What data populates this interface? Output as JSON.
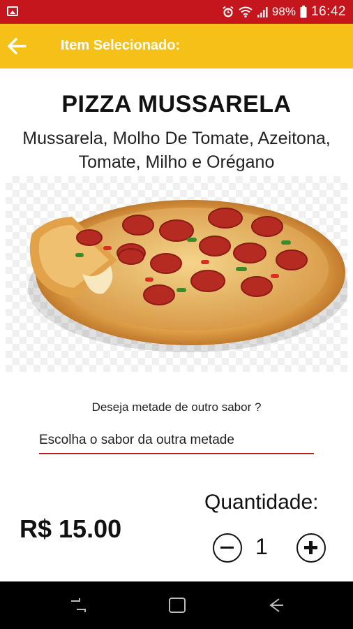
{
  "status_bar": {
    "battery": "98%",
    "time": "16:42",
    "icons": [
      "image-icon",
      "alarm-icon",
      "wifi-icon",
      "signal-icon",
      "battery-icon"
    ]
  },
  "app_bar": {
    "title": "Item Selecionado:",
    "back_icon": "arrow-left-icon",
    "colors": {
      "background": "#f5c018",
      "text": "#ffffff"
    }
  },
  "product": {
    "name": "PIZZA MUSSARELA",
    "description": "Mussarela, Molho De Tomate, Azeitona, Tomate, Milho e Orégano",
    "image": "pizza-photo"
  },
  "half_flavor": {
    "question": "Deseja metade de outro sabor ?",
    "select_placeholder": "Escolha o sabor da outra metade"
  },
  "order": {
    "price": "R$ 15.00",
    "quantity_label": "Quantidade:",
    "quantity": "1"
  },
  "nav_bar": {
    "icons": [
      "recent-apps-icon",
      "home-icon",
      "back-icon"
    ]
  },
  "colors": {
    "status_bar": "#c5161d",
    "accent_underline": "#b3201f"
  }
}
